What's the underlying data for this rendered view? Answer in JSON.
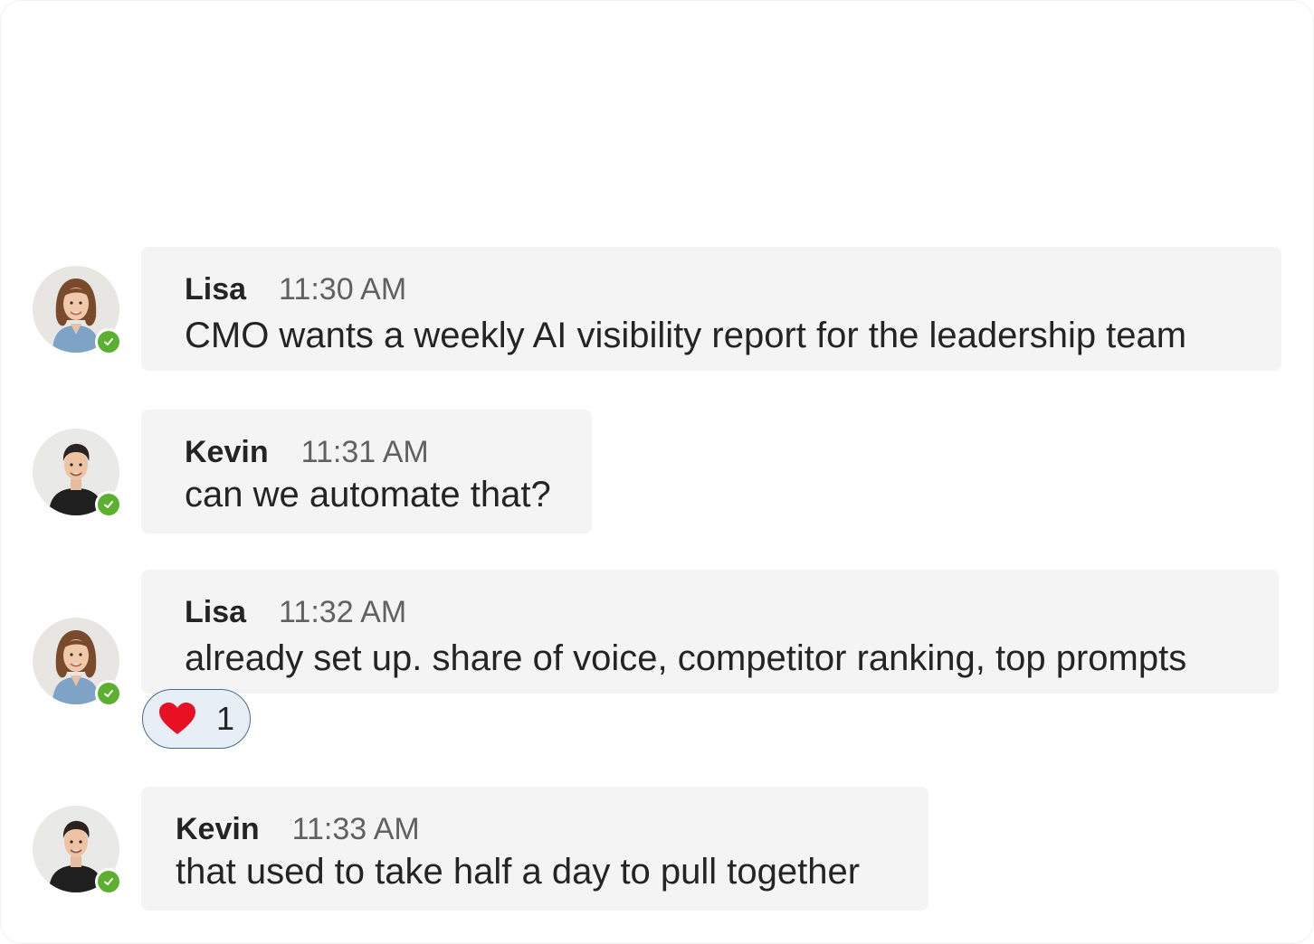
{
  "messages": [
    {
      "sender": "Lisa",
      "time": "11:30 AM",
      "text": "CMO wants a weekly AI visibility report for the leadership team",
      "avatar": "lisa-avatar",
      "presence": "available"
    },
    {
      "sender": "Kevin",
      "time": "11:31 AM",
      "text": "can we automate that?",
      "avatar": "kevin-avatar",
      "presence": "available"
    },
    {
      "sender": "Lisa",
      "time": "11:32 AM",
      "text": "already set up. share of voice, competitor ranking, top prompts",
      "avatar": "lisa-avatar",
      "presence": "available",
      "reaction": {
        "icon": "heart-icon",
        "count": "1"
      }
    },
    {
      "sender": "Kevin",
      "time": "11:33 AM",
      "text": "that used to take half a day to pull together",
      "avatar": "kevin-avatar",
      "presence": "available"
    }
  ],
  "colors": {
    "bubble": "#f4f4f4",
    "presence_available": "#5bb02f",
    "heart": "#e81123",
    "reaction_border": "#4a6a8a"
  }
}
